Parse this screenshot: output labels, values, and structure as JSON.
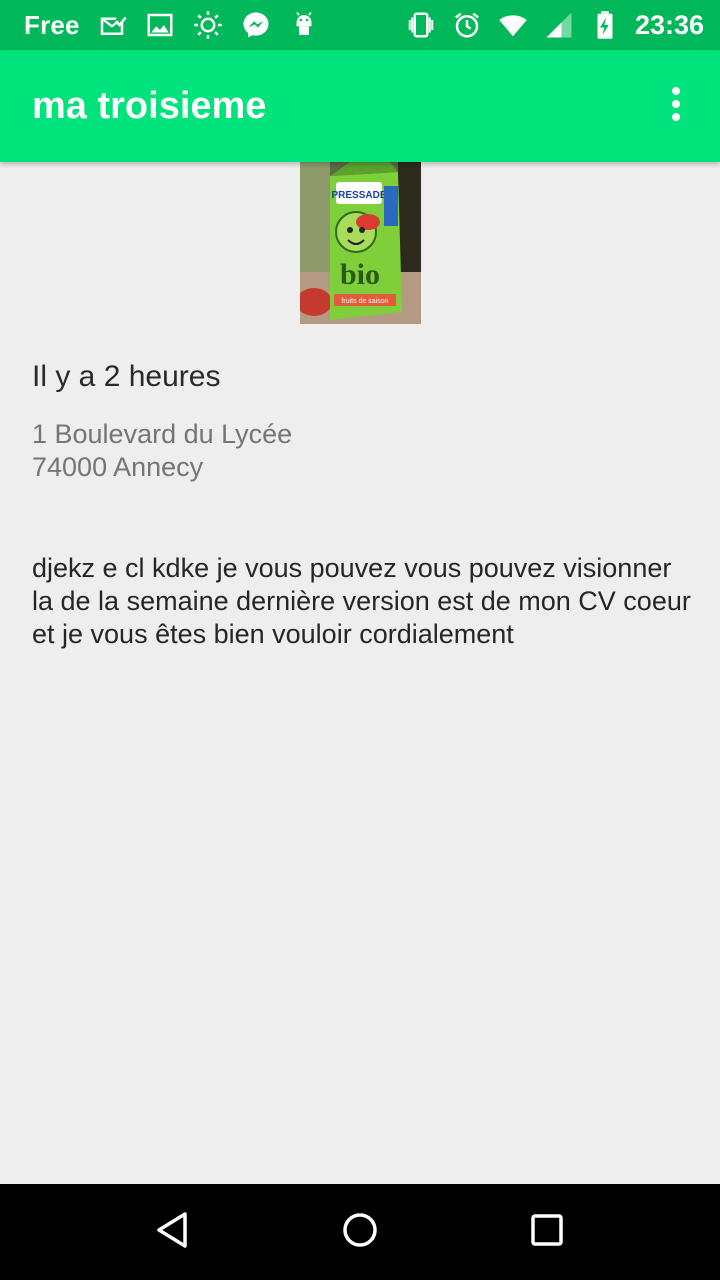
{
  "status_bar": {
    "carrier": "Free",
    "time": "23:36",
    "left_icons": [
      "mail-icon",
      "image-icon",
      "brightness-icon",
      "messenger-icon",
      "android-icon"
    ],
    "right_icons": [
      "vibrate-icon",
      "alarm-icon",
      "wifi-icon",
      "signal-icon",
      "battery-charging-icon"
    ]
  },
  "app_bar": {
    "title": "ma troisieme",
    "menu_icon": "more-vert-icon"
  },
  "photo": {
    "brand": "PRESSADE",
    "product": "bio",
    "flavor": "fruits de saison"
  },
  "detail": {
    "time_ago": "Il y a 2 heures",
    "address_line1": "1 Boulevard du Lycée",
    "address_line2": "74000 Annecy",
    "description": "djekz e cl kdke je vous pouvez vous pouvez visionner la de la semaine dernière version est de mon CV coeur et je vous êtes bien vouloir cordialement"
  },
  "nav_bar": {
    "icons": [
      "back-icon",
      "home-icon",
      "recents-icon"
    ]
  },
  "colors": {
    "status_bar": "#00b85a",
    "app_bar": "#00e27a",
    "background": "#eeeeee"
  }
}
